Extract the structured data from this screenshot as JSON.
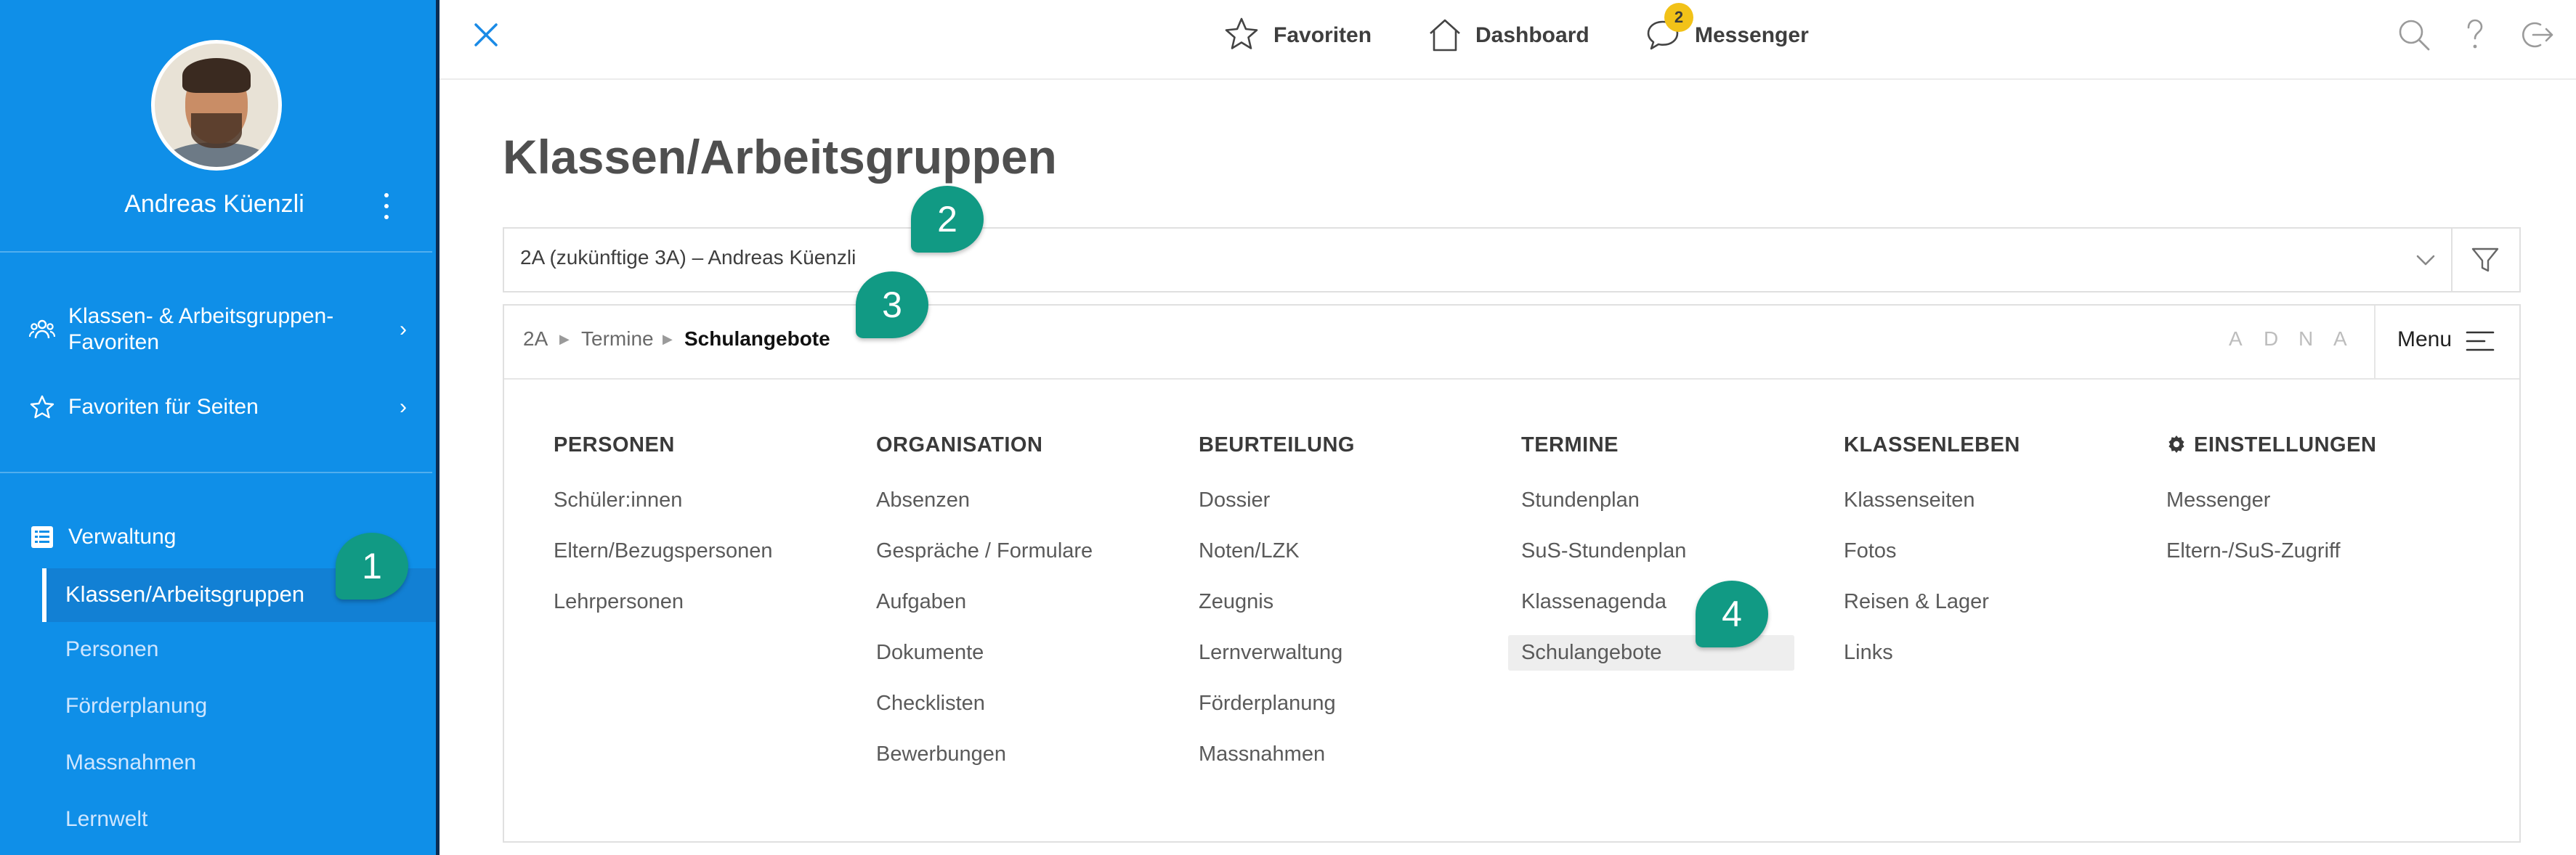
{
  "sidebar": {
    "user_name": "Andreas Küenzli",
    "links": [
      {
        "label": "Klassen- & Arbeitsgruppen-",
        "label2": "Favoriten",
        "icon": "people-icon"
      },
      {
        "label": "Favoriten für Seiten",
        "icon": "star-icon"
      }
    ],
    "section": {
      "label": "Verwaltung",
      "icon": "list-icon"
    },
    "sub_items": [
      "Klassen/Arbeitsgruppen",
      "Personen",
      "Förderplanung",
      "Massnahmen",
      "Lernwelt"
    ],
    "active_sub": "Klassen/Arbeitsgruppen"
  },
  "topbar": {
    "favoriten": "Favoriten",
    "dashboard": "Dashboard",
    "messenger": "Messenger",
    "messenger_badge": "2"
  },
  "main": {
    "title": "Klassen/Arbeitsgruppen",
    "class_select_value": "2A (zukünftige 3A) – Andreas Küenzli",
    "breadcrumb": [
      "2A",
      "Termine",
      "Schulangebote"
    ],
    "view_letters": [
      "A",
      "D",
      "N",
      "A"
    ],
    "menu_label": "Menu",
    "columns": [
      {
        "heading": "PERSONEN",
        "items": [
          "Schüler:innen",
          "Eltern/Bezugspersonen",
          "Lehrpersonen"
        ]
      },
      {
        "heading": "ORGANISATION",
        "items": [
          "Absenzen",
          "Gespräche / Formulare",
          "Aufgaben",
          "Dokumente",
          "Checklisten",
          "Bewerbungen"
        ]
      },
      {
        "heading": "BEURTEILUNG",
        "items": [
          "Dossier",
          "Noten/LZK",
          "Zeugnis",
          "Lernverwaltung",
          "Förderplanung",
          "Massnahmen"
        ]
      },
      {
        "heading": "TERMINE",
        "items": [
          "Stundenplan",
          "SuS-Stundenplan",
          "Klassenagenda",
          "Schulangebote"
        ]
      },
      {
        "heading": "KLASSENLEBEN",
        "items": [
          "Klassenseiten",
          "Fotos",
          "Reisen & Lager",
          "Links"
        ]
      },
      {
        "heading": "EINSTELLUNGEN",
        "items": [
          "Messenger",
          "Eltern-/SuS-Zugriff"
        ]
      }
    ],
    "selected_item": "Schulangebote"
  },
  "callouts": [
    "1",
    "2",
    "3",
    "4"
  ],
  "colors": {
    "sidebar": "#0f8fe8",
    "callout": "#119a84",
    "badge": "#f2c218"
  }
}
